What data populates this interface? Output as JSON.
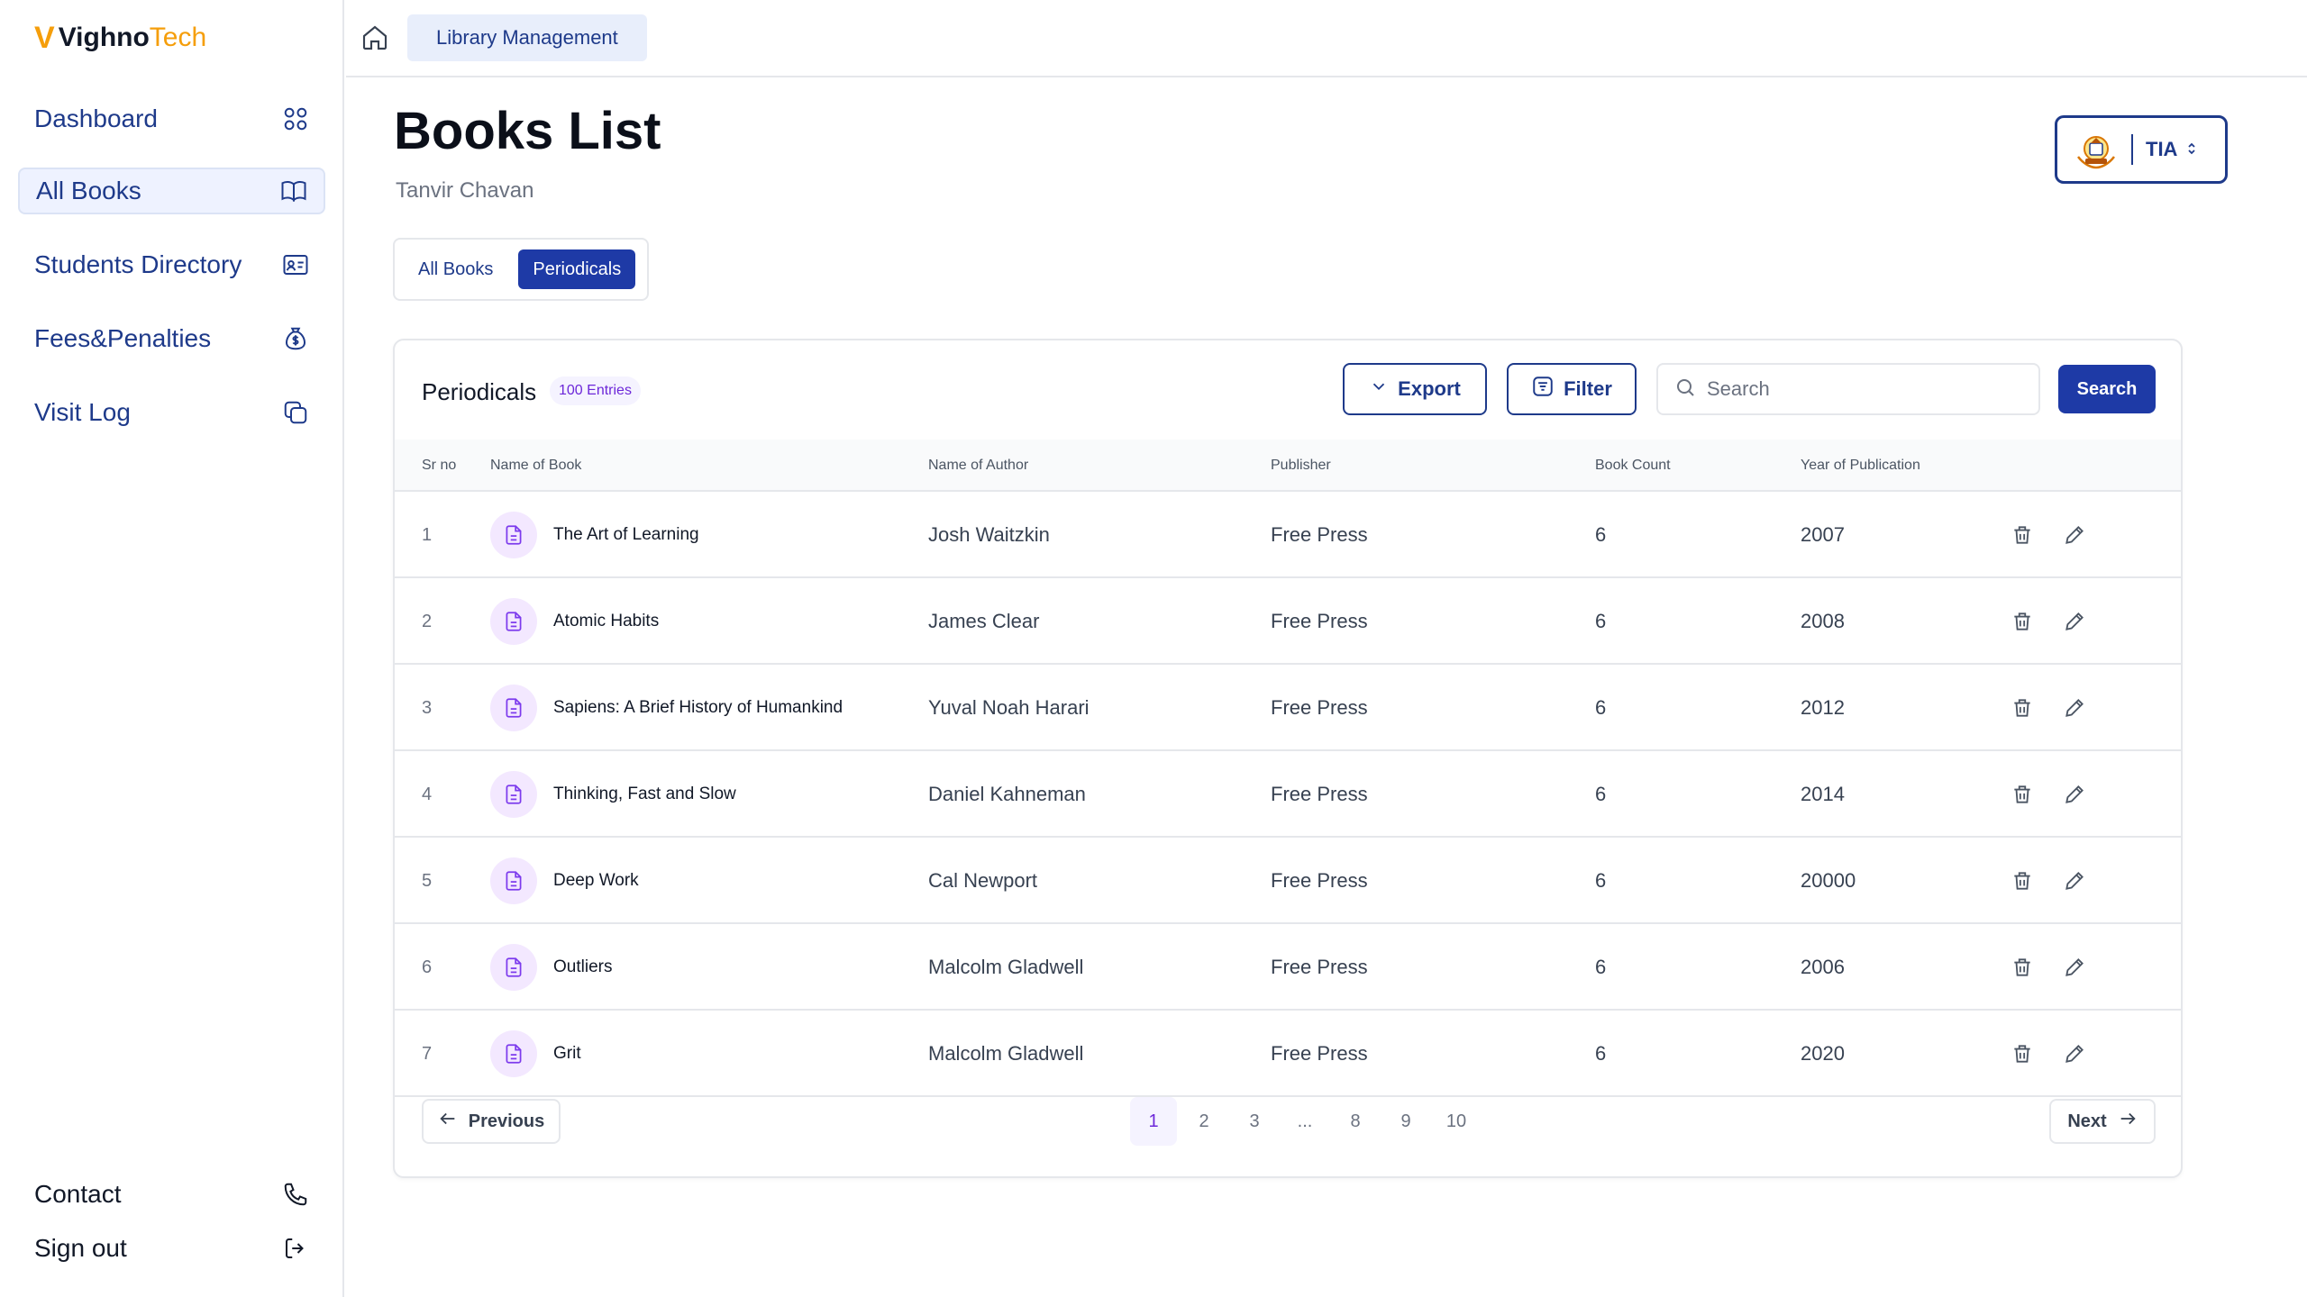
{
  "brand": {
    "mark": "V",
    "name_part1": "Vighno",
    "name_part2": "Tech"
  },
  "sidebar": {
    "items": [
      {
        "label": "Dashboard",
        "icon": "grid-icon"
      },
      {
        "label": "All Books",
        "icon": "open-book-icon",
        "active": true
      },
      {
        "label": "Students Directory",
        "icon": "id-card-icon"
      },
      {
        "label": "Fees&Penalties",
        "icon": "money-bag-icon"
      },
      {
        "label": "Visit Log",
        "icon": "copy-icon"
      }
    ],
    "bottom": [
      {
        "label": "Contact",
        "icon": "phone-icon"
      },
      {
        "label": "Sign out",
        "icon": "sign-out-icon"
      }
    ]
  },
  "topbar": {
    "breadcrumb": "Library Management",
    "home_icon": "home-icon"
  },
  "header": {
    "title": "Books List",
    "subtitle": "Tanvir Chavan",
    "org_name": "TIA"
  },
  "tabs": [
    {
      "label": "All Books"
    },
    {
      "label": "Periodicals",
      "active": true
    }
  ],
  "card": {
    "title": "Periodicals",
    "entries_badge": "100 Entries",
    "export_label": "Export",
    "filter_label": "Filter",
    "search_placeholder": "Search",
    "search_button": "Search"
  },
  "table": {
    "columns": [
      "Sr no",
      "Name of Book",
      "Name of Author",
      "Publisher",
      "Book Count",
      "Year of Publication"
    ],
    "rows": [
      {
        "sr": "1",
        "book": "The Art of Learning",
        "author": "Josh Waitzkin",
        "publisher": "Free Press",
        "count": "6",
        "year": "2007"
      },
      {
        "sr": "2",
        "book": "Atomic Habits",
        "author": "James Clear",
        "publisher": "Free Press",
        "count": "6",
        "year": "2008"
      },
      {
        "sr": "3",
        "book": "Sapiens: A Brief History of Humankind",
        "author": "Yuval Noah Harari",
        "publisher": "Free Press",
        "count": "6",
        "year": "2012"
      },
      {
        "sr": "4",
        "book": "Thinking, Fast and Slow",
        "author": "Daniel Kahneman",
        "publisher": "Free Press",
        "count": "6",
        "year": "2014"
      },
      {
        "sr": "5",
        "book": "Deep Work",
        "author": "Cal Newport",
        "publisher": "Free Press",
        "count": "6",
        "year": "20000"
      },
      {
        "sr": "6",
        "book": "Outliers",
        "author": "Malcolm Gladwell",
        "publisher": "Free Press",
        "count": "6",
        "year": "2006"
      },
      {
        "sr": "7",
        "book": "Grit",
        "author": "Malcolm Gladwell",
        "publisher": "Free Press",
        "count": "6",
        "year": "2020"
      }
    ]
  },
  "pagination": {
    "previous": "Previous",
    "next": "Next",
    "pages": [
      "1",
      "2",
      "3",
      "...",
      "8",
      "9",
      "10"
    ],
    "current": "1"
  },
  "colors": {
    "primary": "#1e3aa6",
    "navy": "#1e3a8a",
    "accent": "#f59e0b",
    "badge_purple": "#6d28d9"
  }
}
